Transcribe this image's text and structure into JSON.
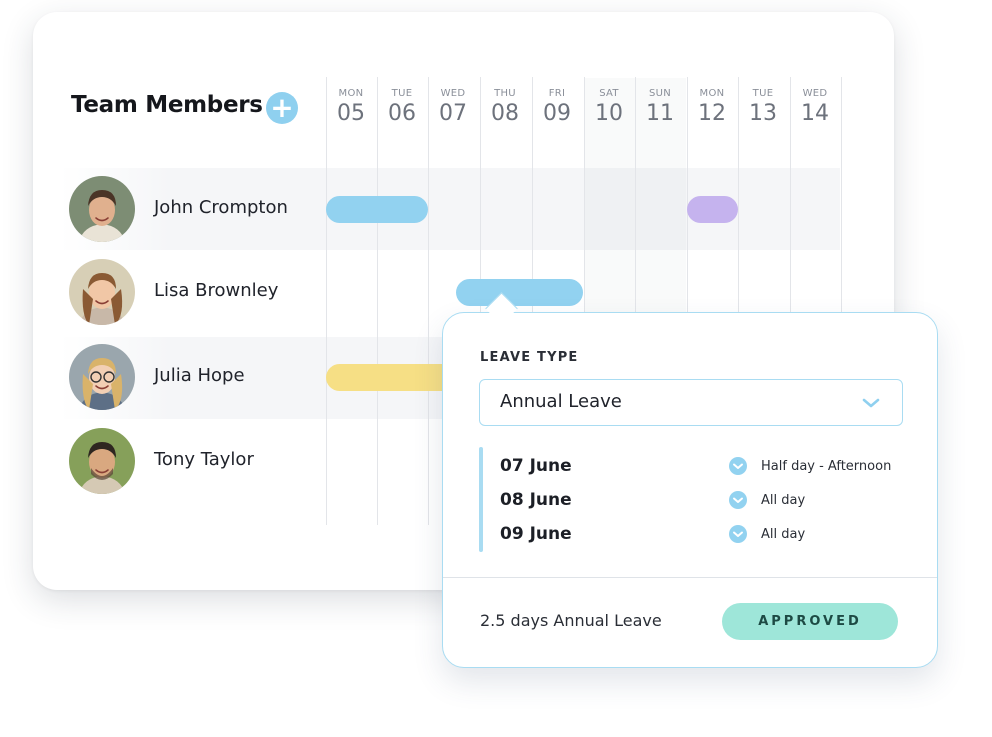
{
  "header": {
    "title": "Team Members",
    "add_icon": "plus-circle-icon"
  },
  "days": [
    {
      "name": "MON",
      "num": "05",
      "weekend": false
    },
    {
      "name": "TUE",
      "num": "06",
      "weekend": false
    },
    {
      "name": "WED",
      "num": "07",
      "weekend": false
    },
    {
      "name": "THU",
      "num": "08",
      "weekend": false
    },
    {
      "name": "FRI",
      "num": "09",
      "weekend": false
    },
    {
      "name": "SAT",
      "num": "10",
      "weekend": true
    },
    {
      "name": "SUN",
      "num": "11",
      "weekend": true
    },
    {
      "name": "MON",
      "num": "12",
      "weekend": false
    },
    {
      "name": "TUE",
      "num": "13",
      "weekend": false
    },
    {
      "name": "WED",
      "num": "14",
      "weekend": false
    }
  ],
  "members": [
    {
      "name": "John Crompton"
    },
    {
      "name": "Lisa Brownley"
    },
    {
      "name": "Julia Hope"
    },
    {
      "name": "Tony Taylor"
    }
  ],
  "bars": [
    {
      "member": "John Crompton",
      "start_day": "05",
      "end_day": "06",
      "color": "#92d2f0"
    },
    {
      "member": "John Crompton",
      "start_day": "12",
      "end_day": "12",
      "color": "#c5b3ee"
    },
    {
      "member": "Lisa Brownley",
      "start_day": "07",
      "end_day": "09",
      "color": "#92d2f0"
    },
    {
      "member": "Julia Hope",
      "start_day": "05",
      "end_day": "07",
      "color": "#f6df85"
    }
  ],
  "popup": {
    "section_label": "LEAVE TYPE",
    "leave_type": "Annual Leave",
    "dates": [
      {
        "date": "07 June",
        "duration": "Half day - Afternoon"
      },
      {
        "date": "08 June",
        "duration": "All day"
      },
      {
        "date": "09 June",
        "duration": "All day"
      }
    ],
    "summary": "2.5 days Annual Leave",
    "status": "APPROVED"
  },
  "colors": {
    "accent": "#8fd0ef",
    "border": "#a9dcf2",
    "approved": "#9ee6d9"
  }
}
